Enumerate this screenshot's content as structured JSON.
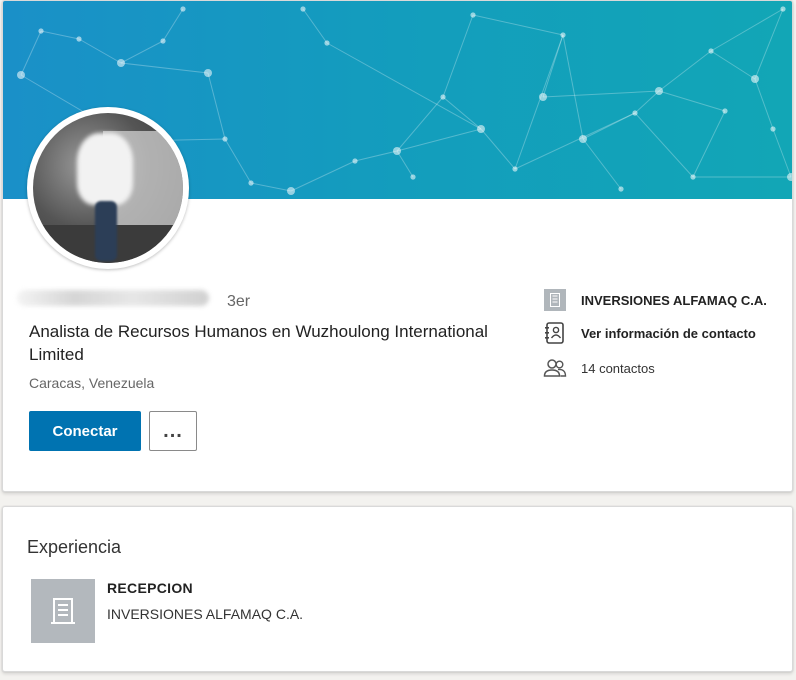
{
  "profile": {
    "degree": "3er",
    "headline": "Analista de Recursos Humanos en Wuzhoulong International Limited",
    "location": "Caracas, Venezuela",
    "connect_label": "Conectar",
    "more_label": "...",
    "current_company": "INVERSIONES ALFAMAQ C.A.",
    "contact_info_label": "Ver información de contacto",
    "connections_label": "14 contactos"
  },
  "experience": {
    "section_title": "Experiencia",
    "items": [
      {
        "role": "RECEPCION",
        "company": "INVERSIONES ALFAMAQ C.A."
      }
    ]
  },
  "colors": {
    "primary": "#0073b1",
    "banner": "#139dbd"
  },
  "icons": [
    "company-logo-icon",
    "contact-card-icon",
    "people-icon",
    "company-building-icon"
  ]
}
